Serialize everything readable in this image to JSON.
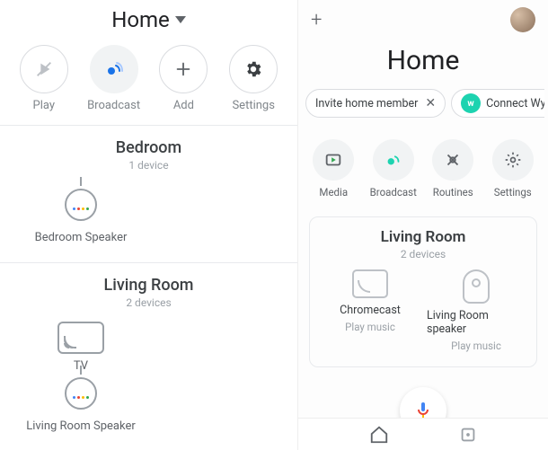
{
  "left": {
    "title": "Home",
    "actions": [
      {
        "id": "play",
        "label": "Play",
        "icon": "play-crossed-icon"
      },
      {
        "id": "broadcast",
        "label": "Broadcast",
        "icon": "broadcast-icon"
      },
      {
        "id": "add",
        "label": "Add",
        "icon": "plus-icon"
      },
      {
        "id": "settings",
        "label": "Settings",
        "icon": "gear-icon"
      }
    ],
    "rooms": [
      {
        "name": "Bedroom",
        "count_label": "1 device",
        "devices": [
          {
            "name": "Bedroom Speaker",
            "icon": "speaker-mini-icon"
          }
        ]
      },
      {
        "name": "Living Room",
        "count_label": "2 devices",
        "devices": [
          {
            "name": "TV",
            "icon": "cast-tv-icon"
          },
          {
            "name": "Living Room Speaker",
            "icon": "speaker-mini-icon"
          }
        ]
      }
    ]
  },
  "right": {
    "title": "Home",
    "chips": [
      {
        "label": "Invite home member",
        "closable": true
      },
      {
        "label": "Connect WyzeCa",
        "badge": true
      }
    ],
    "actions": [
      {
        "id": "media",
        "label": "Media",
        "icon": "media-icon"
      },
      {
        "id": "broadcast",
        "label": "Broadcast",
        "icon": "broadcast-icon",
        "accent": "#1dd3b0"
      },
      {
        "id": "routines",
        "label": "Routines",
        "icon": "routines-icon"
      },
      {
        "id": "settings",
        "label": "Settings",
        "icon": "gear-icon"
      }
    ],
    "room": {
      "name": "Living Room",
      "count_label": "2 devices",
      "devices": [
        {
          "name": "Chromecast",
          "sub": "Play music",
          "icon": "chromecast-icon"
        },
        {
          "name": "Living Room speaker",
          "sub": "Play music",
          "icon": "google-home-icon"
        }
      ]
    },
    "nav": {
      "home_icon": "home-outline-icon",
      "other_icon": "square-dot-icon"
    }
  },
  "colors": {
    "text": "#202124",
    "muted": "#80868b",
    "accent": "#1dd3b0"
  }
}
